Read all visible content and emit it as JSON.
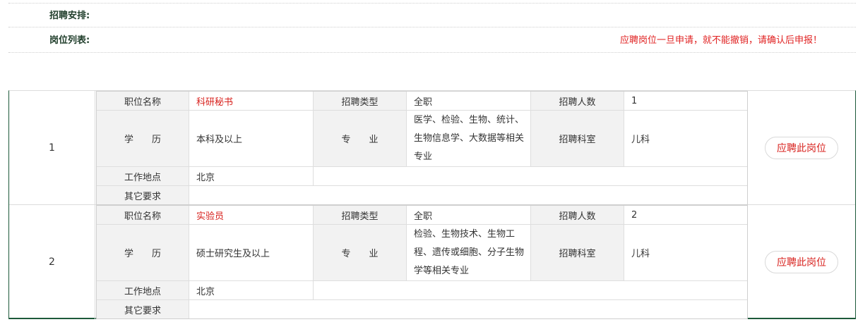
{
  "header": {
    "schedule_label": "招聘安排:",
    "positions_label": "岗位列表:",
    "warning": "应聘岗位一旦申请，就不能撤销，请确认后申报！"
  },
  "labels": {
    "position_name": "职位名称",
    "recruit_type": "招聘类型",
    "headcount": "招聘人数",
    "education": "学　　历",
    "major": "专　　业",
    "department": "招聘科室",
    "location": "工作地点",
    "other": "其它要求",
    "apply": "应聘此岗位"
  },
  "jobs": [
    {
      "index": "1",
      "position_name": "科研秘书",
      "recruit_type": "全职",
      "headcount": "1",
      "education": "本科及以上",
      "major": "医学、检验、生物、统计、生物信息学、大数据等相关专业",
      "department": "儿科",
      "location": "北京",
      "other": ""
    },
    {
      "index": "2",
      "position_name": "实验员",
      "recruit_type": "全职",
      "headcount": "2",
      "education": "硕士研究生及以上",
      "major": "检验、生物技术、生物工程、遗传或细胞、分子生物学等相关专业",
      "department": "儿科",
      "location": "北京",
      "other": ""
    }
  ]
}
